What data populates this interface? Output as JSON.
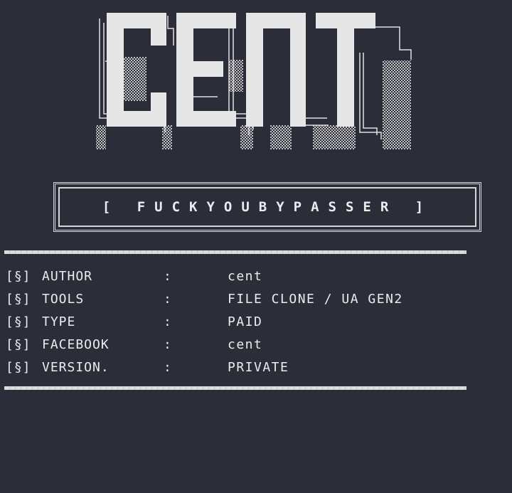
{
  "logo": {
    "text": "CENT"
  },
  "banner": {
    "text": "[ FUCKYOUBYPASSER ]"
  },
  "info": {
    "rows": [
      {
        "tag": "[§]",
        "key": "AUTHOR",
        "sep": ":",
        "value": "cent"
      },
      {
        "tag": "[§]",
        "key": "TOOLS",
        "sep": ":",
        "value": "FILE CLONE / UA GEN2"
      },
      {
        "tag": "[§]",
        "key": "TYPE",
        "sep": ":",
        "value": "PAID"
      },
      {
        "tag": "[§]",
        "key": "FACEBOOK",
        "sep": ":",
        "value": "cent"
      },
      {
        "tag": "[§]",
        "key": "VERSION.",
        "sep": ":",
        "value": "PRIVATE"
      }
    ]
  },
  "colors": {
    "background": "#2b2d38",
    "text": "#ececec",
    "dither": "#bdbdbd"
  }
}
